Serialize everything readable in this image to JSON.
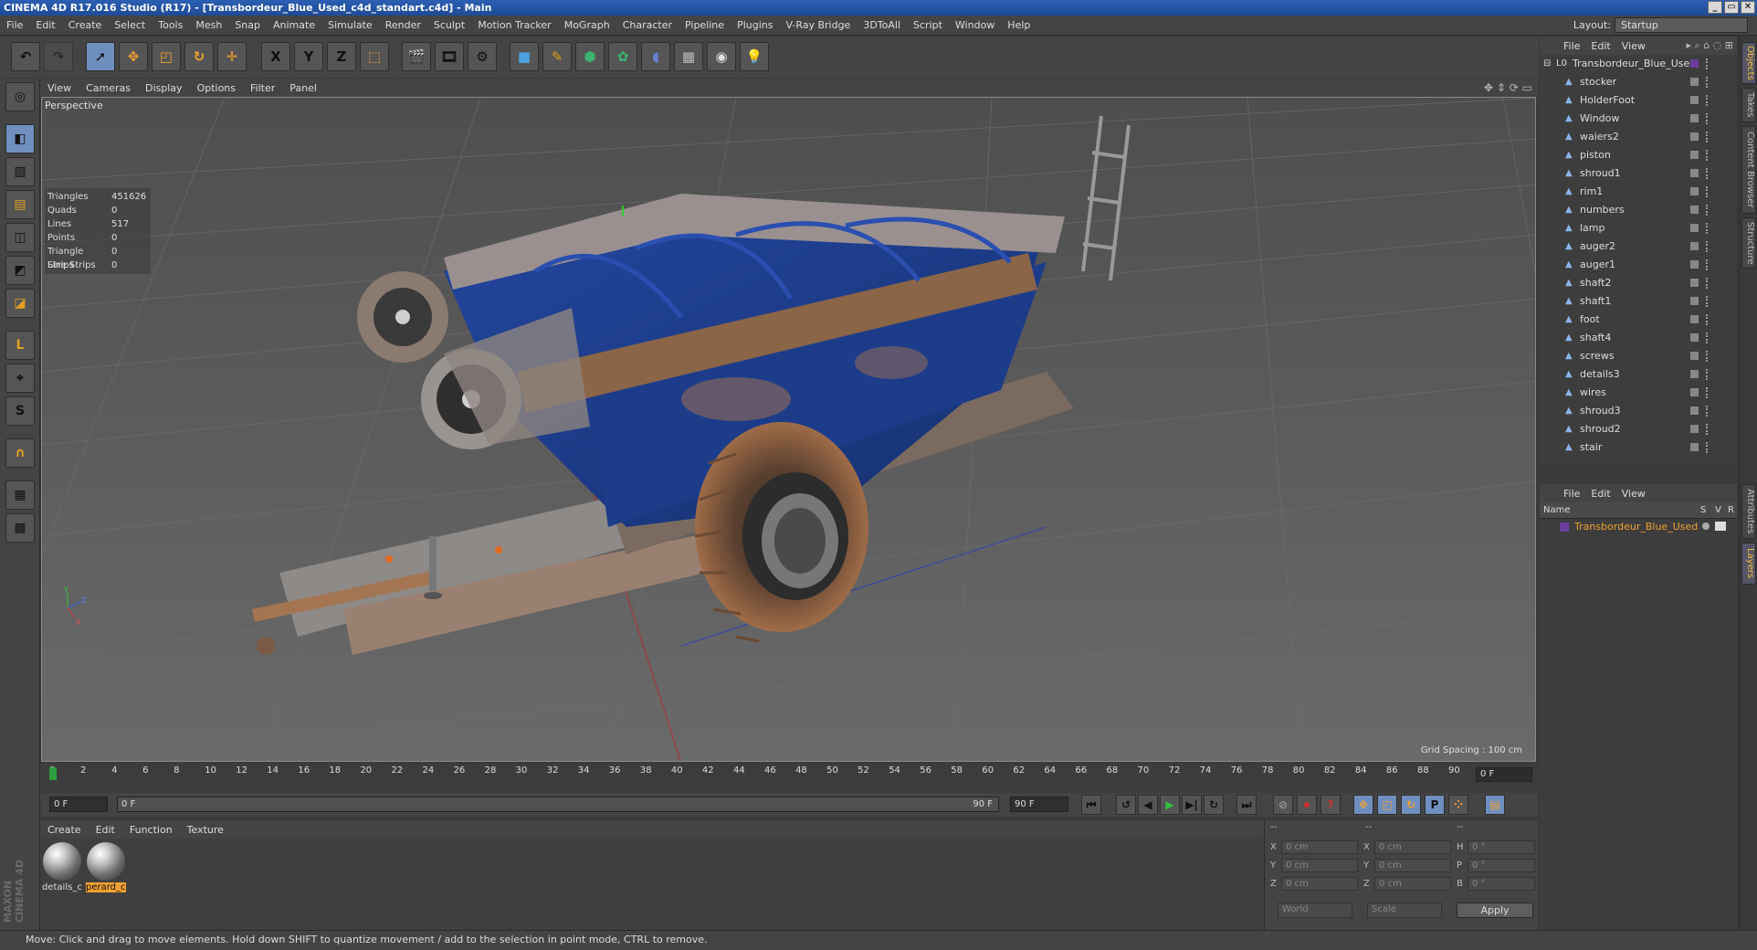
{
  "window": {
    "title": "CINEMA 4D R17.016 Studio (R17) - [Transbordeur_Blue_Used_c4d_standart.c4d] - Main",
    "controls": [
      "_",
      "▭",
      "✕"
    ]
  },
  "menubar": {
    "items": [
      "File",
      "Edit",
      "Create",
      "Select",
      "Tools",
      "Mesh",
      "Snap",
      "Animate",
      "Simulate",
      "Render",
      "Sculpt",
      "Motion Tracker",
      "MoGraph",
      "Character",
      "Pipeline",
      "Plugins",
      "V-Ray Bridge",
      "3DToAll",
      "Script",
      "Window",
      "Help"
    ],
    "layout_label": "Layout:",
    "layout_value": "Startup"
  },
  "toolbar": {
    "axis_x": "X",
    "axis_y": "Y",
    "axis_z": "Z"
  },
  "viewport": {
    "menu": [
      "View",
      "Cameras",
      "Display",
      "Options",
      "Filter",
      "Panel"
    ],
    "label": "Perspective",
    "grid_spacing": "Grid Spacing : 100 cm",
    "stats": [
      {
        "k": "Triangles",
        "v": "451626"
      },
      {
        "k": "Quads",
        "v": "0"
      },
      {
        "k": "Lines",
        "v": "517"
      },
      {
        "k": "Points",
        "v": "0"
      },
      {
        "k": "Triangle Strips",
        "v": "0"
      },
      {
        "k": "Line Strips",
        "v": "0"
      }
    ]
  },
  "timeline": {
    "ticks": [
      "0",
      "2",
      "4",
      "6",
      "8",
      "10",
      "12",
      "14",
      "16",
      "18",
      "20",
      "22",
      "24",
      "26",
      "28",
      "30",
      "32",
      "34",
      "36",
      "38",
      "40",
      "42",
      "44",
      "46",
      "48",
      "50",
      "52",
      "54",
      "56",
      "58",
      "60",
      "62",
      "64",
      "66",
      "68",
      "70",
      "72",
      "74",
      "76",
      "78",
      "80",
      "82",
      "84",
      "86",
      "88",
      "90"
    ],
    "current_frame": "0 F",
    "start_field": "0 F",
    "range_start": "0 F",
    "range_end": "90 F",
    "end_field": "90 F"
  },
  "materials": {
    "menu": [
      "Create",
      "Edit",
      "Function",
      "Texture"
    ],
    "items": [
      {
        "label": "details_c",
        "selected": false
      },
      {
        "label": "perard_c",
        "selected": true
      }
    ]
  },
  "coordinates": {
    "header_left": "--",
    "header_mid": "--",
    "header_right": "--",
    "rows": [
      {
        "a": "X",
        "av": "0 cm",
        "b": "X",
        "bv": "0 cm",
        "c": "H",
        "cv": "0 °"
      },
      {
        "a": "Y",
        "av": "0 cm",
        "b": "Y",
        "bv": "0 cm",
        "c": "P",
        "cv": "0 °"
      },
      {
        "a": "Z",
        "av": "0 cm",
        "b": "Z",
        "bv": "0 cm",
        "c": "B",
        "cv": "0 °"
      }
    ],
    "mode": "World",
    "scale": "Scale",
    "apply": "Apply"
  },
  "objects": {
    "menu": [
      "File",
      "Edit",
      "View"
    ],
    "root": "Transbordeur_Blue_Used",
    "items": [
      "stocker",
      "HolderFoot",
      "Window",
      "waiers2",
      "piston",
      "shroud1",
      "rim1",
      "numbers",
      "lamp",
      "auger2",
      "auger1",
      "shaft2",
      "shaft1",
      "foot",
      "shaft4",
      "screws",
      "details3",
      "wires",
      "shroud3",
      "shroud2",
      "stair"
    ]
  },
  "layers": {
    "menu": [
      "File",
      "Edit",
      "View"
    ],
    "col_name": "Name",
    "col_s": "S",
    "col_v": "V",
    "col_r": "R",
    "row": "Transbordeur_Blue_Used"
  },
  "side_tabs": [
    "Objects",
    "Takes",
    "Content Browser",
    "Structure",
    "Attributes",
    "Layers"
  ],
  "statusbar": {
    "text": "Move: Click and drag to move elements. Hold down SHIFT to quantize movement / add to the selection in point mode, CTRL to remove."
  },
  "colors": {
    "accent_orange": "#f0a030",
    "selection_blue": "#6f8fbf",
    "hopper_blue": "#1f3f8f",
    "rust": "#9c6a44"
  }
}
